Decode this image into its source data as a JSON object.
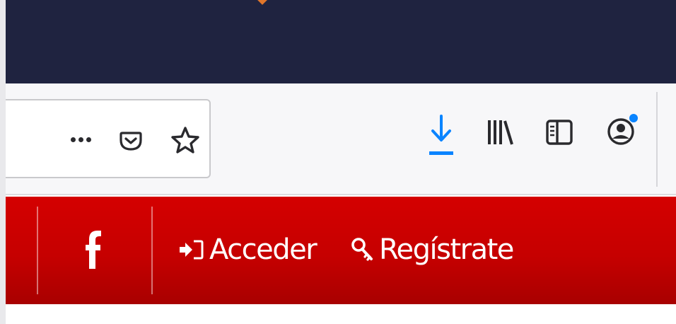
{
  "toolbar": {
    "icons": [
      "more-icon",
      "pocket-icon",
      "bookmark-star-icon",
      "download-icon",
      "library-icon",
      "sidebar-icon",
      "account-icon"
    ],
    "colors": {
      "titlebar": "#1f2340",
      "download_accent": "#0a84ff",
      "notification_dot": "#0a84ff"
    }
  },
  "site_header": {
    "background": "#c60000",
    "social": {
      "icon": "facebook-icon"
    },
    "login": {
      "label": "Acceder",
      "icon": "sign-in-icon"
    },
    "register": {
      "label": "Regístrate",
      "icon": "key-icon"
    }
  }
}
